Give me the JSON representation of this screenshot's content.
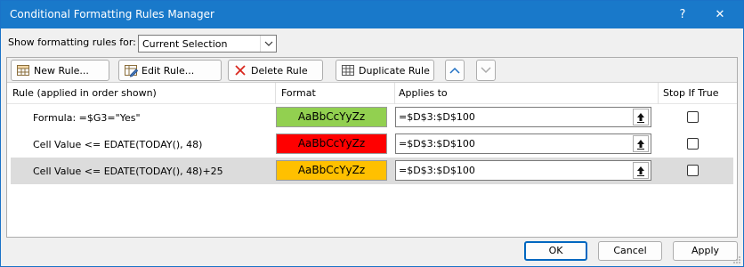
{
  "window": {
    "title": "Conditional Formatting Rules Manager",
    "help": "?",
    "close": "✕"
  },
  "show": {
    "label": "Show formatting rules for:",
    "selected": "Current Selection"
  },
  "toolbar": {
    "new_rule": "New Rule...",
    "edit_rule": "Edit Rule...",
    "delete_rule": "Delete Rule",
    "duplicate_rule": "Duplicate Rule"
  },
  "columns": {
    "rule": "Rule (applied in order shown)",
    "format": "Format",
    "applies_to": "Applies to",
    "stop_if_true": "Stop If True"
  },
  "rules": [
    {
      "rule": "Formula: =$G3=\"Yes\"",
      "format_preview": "AaBbCcYyZz",
      "applies_to": "=$D$3:$D$100",
      "stop_if_true": false,
      "color": "#92d050",
      "text_color": "#000000"
    },
    {
      "rule": "Cell Value <= EDATE(TODAY(), 48)",
      "format_preview": "AaBbCcYyZz",
      "applies_to": "=$D$3:$D$100",
      "stop_if_true": false,
      "color": "#ff0000",
      "text_color": "#000000"
    },
    {
      "rule": "Cell Value <= EDATE(TODAY(), 48)+25",
      "format_preview": "AaBbCcYyZz",
      "applies_to": "=$D$3:$D$100",
      "stop_if_true": false,
      "color": "#ffc000",
      "text_color": "#000000"
    }
  ],
  "buttons": {
    "ok": "OK",
    "cancel": "Cancel",
    "apply": "Apply"
  }
}
